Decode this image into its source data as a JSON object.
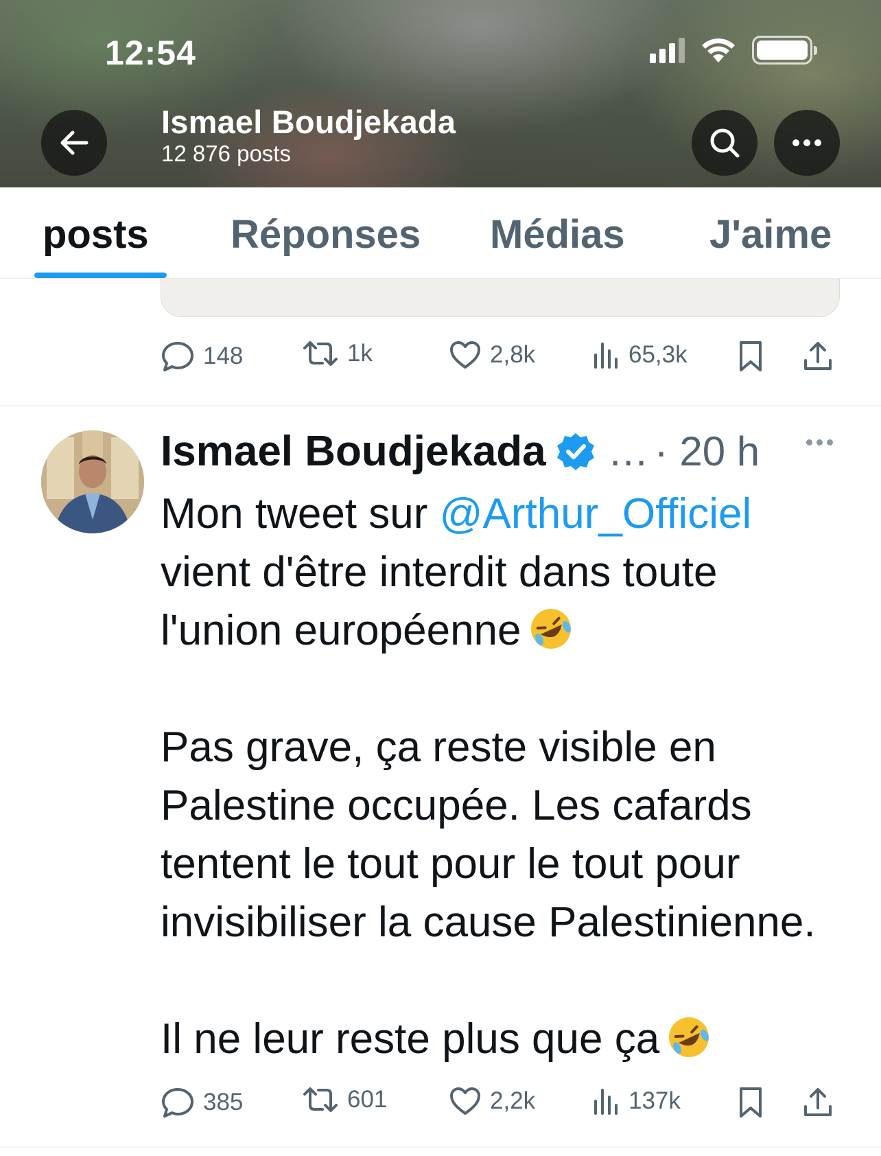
{
  "status_bar": {
    "time": "12:54"
  },
  "header": {
    "name": "Ismael Boudjekada",
    "posts_count": "12 876 posts"
  },
  "tabs": [
    {
      "label": "posts",
      "active": true
    },
    {
      "label": "Réponses",
      "active": false
    },
    {
      "label": "Médias",
      "active": false
    },
    {
      "label": "J'aime",
      "active": false
    }
  ],
  "previous_post": {
    "replies": "148",
    "reposts": "1k",
    "likes": "2,8k",
    "views": "65,3k"
  },
  "post": {
    "author": "Ismael Boudjekada",
    "ellipsis": "…",
    "time": "· 20 h",
    "text_before_mention": "Mon tweet sur ",
    "mention": "@Arthur_Officiel",
    "line_2": "vient d'être interdit dans toute",
    "line_3": "l'union européenne",
    "paragraph_2_line_1": "Pas grave, ça reste visible en",
    "paragraph_2_line_2": "Palestine occupée. Les cafards",
    "paragraph_2_line_3": "tentent le tout pour le tout pour",
    "paragraph_2_line_4": "invisibiliser la cause Palestinienne.",
    "paragraph_3": "Il ne leur reste plus que ça",
    "emoji": "rolling-on-the-floor-laughing",
    "replies": "385",
    "reposts": "601",
    "likes": "2,2k",
    "views": "137k"
  },
  "colors": {
    "accent": "#1d9bf0",
    "secondary_text": "#536471",
    "primary_text": "#0f1419"
  }
}
